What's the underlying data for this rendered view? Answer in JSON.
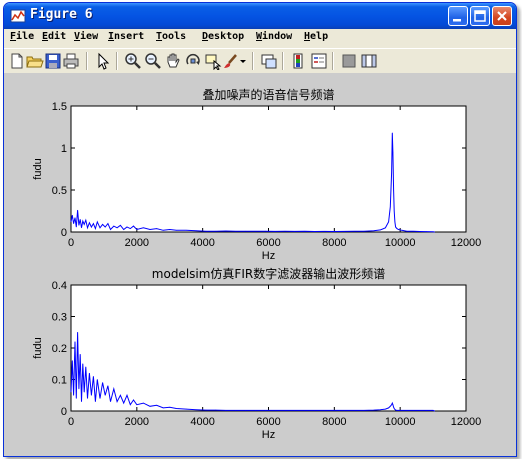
{
  "window": {
    "title": "Figure 6"
  },
  "menu": [
    {
      "label": "File",
      "name": "menu-file"
    },
    {
      "label": "Edit",
      "name": "menu-edit"
    },
    {
      "label": "View",
      "name": "menu-view"
    },
    {
      "label": "Insert",
      "name": "menu-insert"
    },
    {
      "label": "Tools",
      "name": "menu-tools"
    },
    {
      "label": "Desktop",
      "name": "menu-desktop"
    },
    {
      "label": "Window",
      "name": "menu-window"
    },
    {
      "label": "Help",
      "name": "menu-help"
    }
  ],
  "toolbar": {
    "icons": [
      "new-file-icon",
      "open-folder-icon",
      "save-icon",
      "print-icon",
      "pointer-arrow-icon",
      "zoom-in-icon",
      "zoom-out-icon",
      "pan-hand-icon",
      "rotate-3d-icon",
      "data-cursor-icon",
      "brush-icon",
      "insert-colorbar-icon",
      "insert-legend-icon",
      "hide-plot-tools-icon",
      "show-plot-tools-icon"
    ]
  },
  "chart_data": [
    {
      "type": "line",
      "title": "叠加噪声的语音信号频谱",
      "xlabel": "Hz",
      "ylabel": "fudu",
      "xlim": [
        0,
        12000
      ],
      "ylim": [
        0,
        1.5
      ],
      "xticks": [
        "0",
        "2000",
        "4000",
        "6000",
        "8000",
        "10000",
        "12000"
      ],
      "yticks": [
        "0",
        "0.5",
        "1",
        "1.5"
      ],
      "line_color": "#0000ff",
      "series": [
        {
          "x": [
            0,
            40,
            80,
            120,
            160,
            200,
            240,
            280,
            320,
            360,
            400,
            450,
            500,
            560,
            620,
            680,
            740,
            800,
            880,
            960,
            1040,
            1120,
            1200,
            1300,
            1400,
            1500,
            1600,
            1700,
            1800,
            1900,
            2000,
            2200,
            2400,
            2600,
            2800,
            3000,
            3200,
            3500,
            3800,
            4100,
            4400,
            4700,
            5000,
            5300,
            5600,
            5900,
            6200,
            6500,
            6800,
            7100,
            7400,
            7700,
            8000,
            8300,
            8600,
            8900,
            9200,
            9400,
            9550,
            9650,
            9700,
            9740,
            9760,
            9780,
            9800,
            9820,
            9840,
            9860,
            9900,
            9950,
            10050,
            10200,
            10400,
            10600,
            10800,
            11000,
            11050
          ],
          "y": [
            0.12,
            0.2,
            0.1,
            0.17,
            0.06,
            0.26,
            0.08,
            0.15,
            0.05,
            0.13,
            0.09,
            0.14,
            0.05,
            0.11,
            0.06,
            0.1,
            0.04,
            0.12,
            0.05,
            0.09,
            0.06,
            0.1,
            0.03,
            0.07,
            0.05,
            0.08,
            0.03,
            0.06,
            0.04,
            0.07,
            0.03,
            0.05,
            0.03,
            0.04,
            0.02,
            0.03,
            0.02,
            0.02,
            0.015,
            0.01,
            0.01,
            0.012,
            0.008,
            0.01,
            0.008,
            0.009,
            0.007,
            0.008,
            0.007,
            0.008,
            0.006,
            0.007,
            0.006,
            0.007,
            0.008,
            0.01,
            0.015,
            0.025,
            0.05,
            0.12,
            0.3,
            0.7,
            1.18,
            0.95,
            0.5,
            0.25,
            0.12,
            0.06,
            0.04,
            0.03,
            0.02,
            0.01,
            0.008,
            0.006,
            0.005,
            0.004,
            0.0
          ]
        }
      ]
    },
    {
      "type": "line",
      "title": "modelsim仿真FIR数字滤波器输出波形频谱",
      "xlabel": "Hz",
      "ylabel": "fudu",
      "xlim": [
        0,
        12000
      ],
      "ylim": [
        0,
        0.4
      ],
      "xticks": [
        "0",
        "2000",
        "4000",
        "6000",
        "8000",
        "10000",
        "12000"
      ],
      "yticks": [
        "0",
        "0.1",
        "0.2",
        "0.3",
        "0.4"
      ],
      "line_color": "#0000ff",
      "series": [
        {
          "x": [
            0,
            40,
            80,
            120,
            160,
            200,
            240,
            280,
            320,
            360,
            400,
            450,
            500,
            560,
            620,
            680,
            740,
            800,
            880,
            960,
            1040,
            1120,
            1200,
            1300,
            1400,
            1500,
            1600,
            1700,
            1800,
            1900,
            2000,
            2200,
            2400,
            2600,
            2800,
            3000,
            3200,
            3500,
            3800,
            4100,
            4400,
            4700,
            5000,
            5300,
            5600,
            5900,
            6200,
            6500,
            6800,
            7100,
            7400,
            7700,
            8000,
            8300,
            8600,
            8900,
            9200,
            9400,
            9550,
            9650,
            9700,
            9740,
            9760,
            9780,
            9800,
            9820,
            9840,
            9860,
            9900,
            9950,
            10050,
            10200,
            10400,
            10600,
            10800,
            11000,
            11050
          ],
          "y": [
            0.06,
            0.16,
            0.05,
            0.22,
            0.04,
            0.25,
            0.07,
            0.18,
            0.03,
            0.15,
            0.06,
            0.14,
            0.04,
            0.12,
            0.05,
            0.11,
            0.03,
            0.1,
            0.04,
            0.09,
            0.05,
            0.08,
            0.03,
            0.07,
            0.03,
            0.05,
            0.025,
            0.05,
            0.02,
            0.035,
            0.02,
            0.025,
            0.015,
            0.018,
            0.01,
            0.012,
            0.008,
            0.006,
            0.004,
            0.003,
            0.003,
            0.002,
            0.002,
            0.002,
            0.002,
            0.002,
            0.002,
            0.002,
            0.002,
            0.002,
            0.002,
            0.002,
            0.002,
            0.002,
            0.002,
            0.002,
            0.003,
            0.004,
            0.006,
            0.01,
            0.015,
            0.02,
            0.025,
            0.02,
            0.012,
            0.008,
            0.005,
            0.003,
            0.002,
            0.002,
            0.002,
            0.002,
            0.002,
            0.002,
            0.002,
            0.002,
            0.0
          ]
        }
      ]
    }
  ]
}
